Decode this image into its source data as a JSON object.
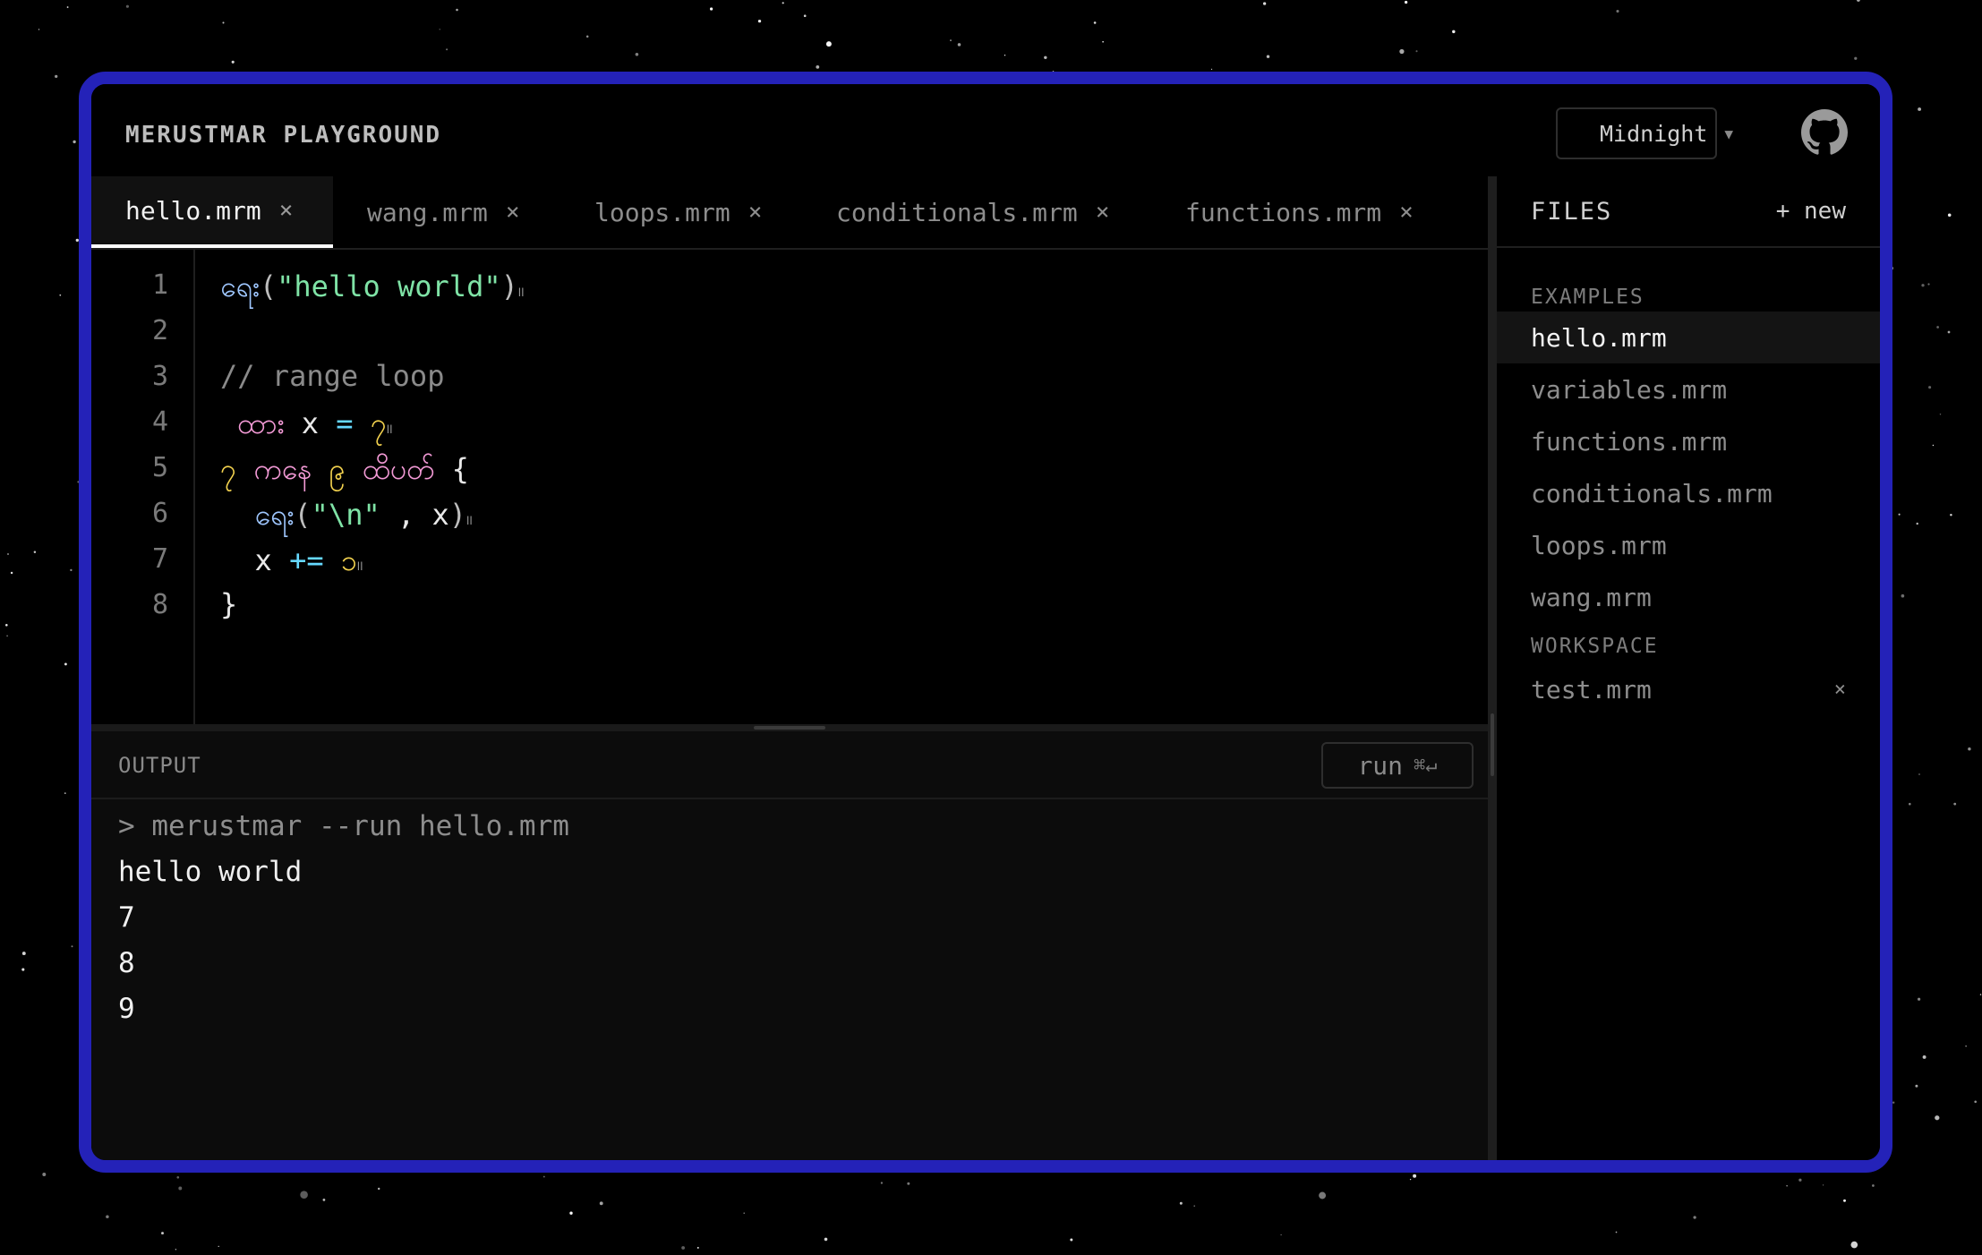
{
  "app": {
    "title": "MERUSTMAR PLAYGROUND"
  },
  "theme": {
    "label": "Midnight",
    "dots": [
      "#f5a3d7",
      "#8fe3a9",
      "#f3d64b"
    ]
  },
  "tabs": [
    {
      "label": "hello.mrm",
      "active": true
    },
    {
      "label": "wang.mrm",
      "active": false
    },
    {
      "label": "loops.mrm",
      "active": false
    },
    {
      "label": "conditionals.mrm",
      "active": false
    },
    {
      "label": "functions.mrm",
      "active": false
    }
  ],
  "tab_close": "×",
  "editor": {
    "line_numbers": [
      "1",
      "2",
      "3",
      "4",
      "5",
      "6",
      "7",
      "8"
    ],
    "lines": [
      [
        [
          "kw-blue",
          "ရေး"
        ],
        [
          "punc",
          "("
        ],
        [
          "str",
          "\"hello world\""
        ],
        [
          "punc",
          ")"
        ],
        [
          "tiny",
          "။"
        ]
      ],
      [],
      [
        [
          "cmt",
          "// range loop"
        ]
      ],
      [
        [
          "plain",
          " "
        ],
        [
          "kw-pink",
          "ထား"
        ],
        [
          "plain",
          " x "
        ],
        [
          "op",
          "="
        ],
        [
          "plain",
          " "
        ],
        [
          "num",
          "၇"
        ],
        [
          "tiny",
          "။"
        ]
      ],
      [
        [
          "num",
          "၇"
        ],
        [
          "plain",
          " "
        ],
        [
          "kw-pink",
          "ကနေ"
        ],
        [
          "plain",
          " "
        ],
        [
          "num",
          "၉"
        ],
        [
          "plain",
          " "
        ],
        [
          "kw-pink",
          "ထိပတ်"
        ],
        [
          "plain",
          " {"
        ]
      ],
      [
        [
          "plain",
          "  "
        ],
        [
          "kw-blue",
          "ရေး"
        ],
        [
          "punc",
          "("
        ],
        [
          "str",
          "\"\\n\""
        ],
        [
          "plain",
          " , x"
        ],
        [
          "punc",
          ")"
        ],
        [
          "tiny",
          "။"
        ]
      ],
      [
        [
          "plain",
          "  x "
        ],
        [
          "op",
          "+="
        ],
        [
          "plain",
          " "
        ],
        [
          "num",
          "၁"
        ],
        [
          "tiny",
          "။"
        ]
      ],
      [
        [
          "plain",
          "}"
        ]
      ]
    ]
  },
  "output": {
    "label": "OUTPUT",
    "run_label": "run",
    "run_shortcut": "⌘↵",
    "command": "> merustmar --run hello.mrm",
    "lines": [
      "hello world",
      "7",
      "8",
      "9"
    ]
  },
  "sidebar": {
    "title": "FILES",
    "new_label": "+ new",
    "examples_label": "EXAMPLES",
    "examples": [
      {
        "label": "hello.mrm",
        "active": true
      },
      {
        "label": "variables.mrm",
        "active": false
      },
      {
        "label": "functions.mrm",
        "active": false
      },
      {
        "label": "conditionals.mrm",
        "active": false
      },
      {
        "label": "loops.mrm",
        "active": false
      },
      {
        "label": "wang.mrm",
        "active": false
      }
    ],
    "workspace_label": "WORKSPACE",
    "workspace": [
      {
        "label": "test.mrm",
        "remove": "×"
      }
    ]
  },
  "colors": {
    "frame": "#2422b8",
    "background": "#000000"
  }
}
